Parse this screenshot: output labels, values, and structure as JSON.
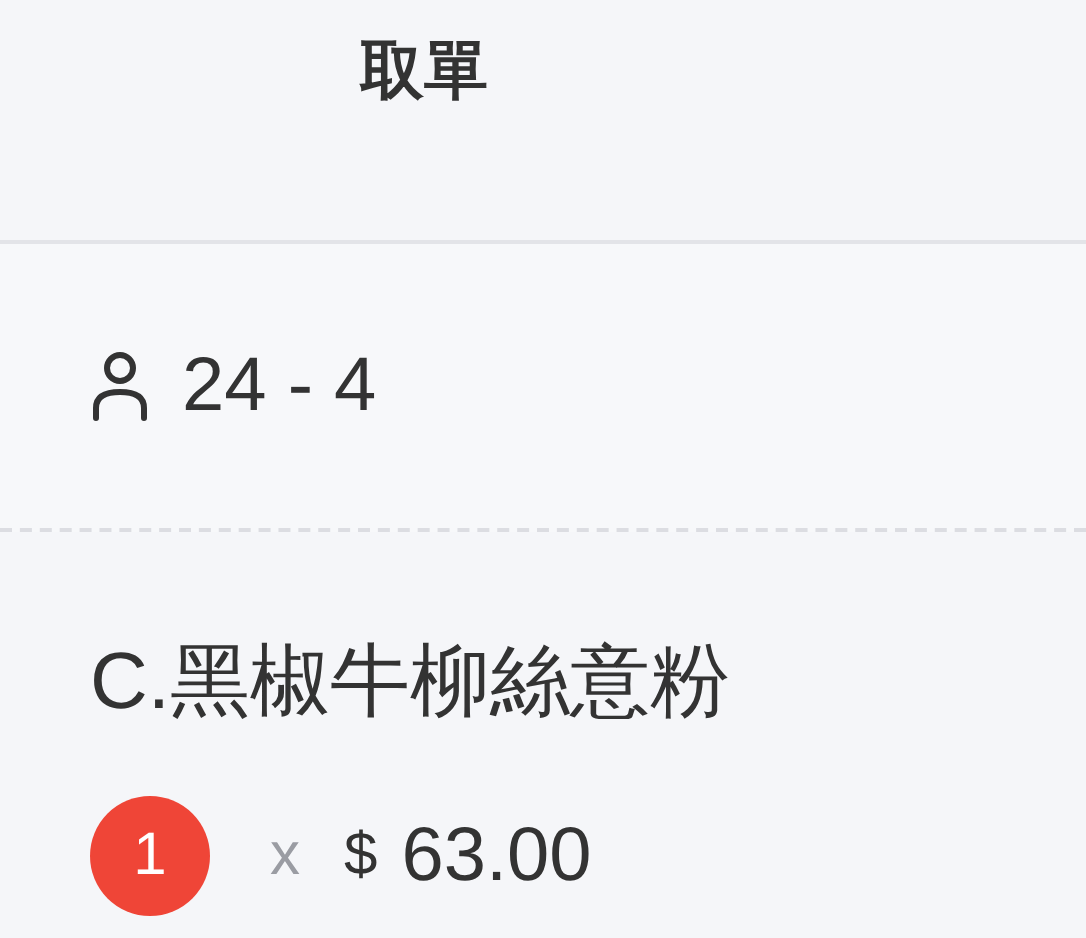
{
  "tabs": [
    {
      "label": "取單"
    }
  ],
  "guest": {
    "text": "24 - 4"
  },
  "items": [
    {
      "name": "C.黑椒牛柳絲意粉",
      "quantity": "1",
      "times": "x",
      "currency": "$",
      "price": "63.00"
    }
  ]
}
